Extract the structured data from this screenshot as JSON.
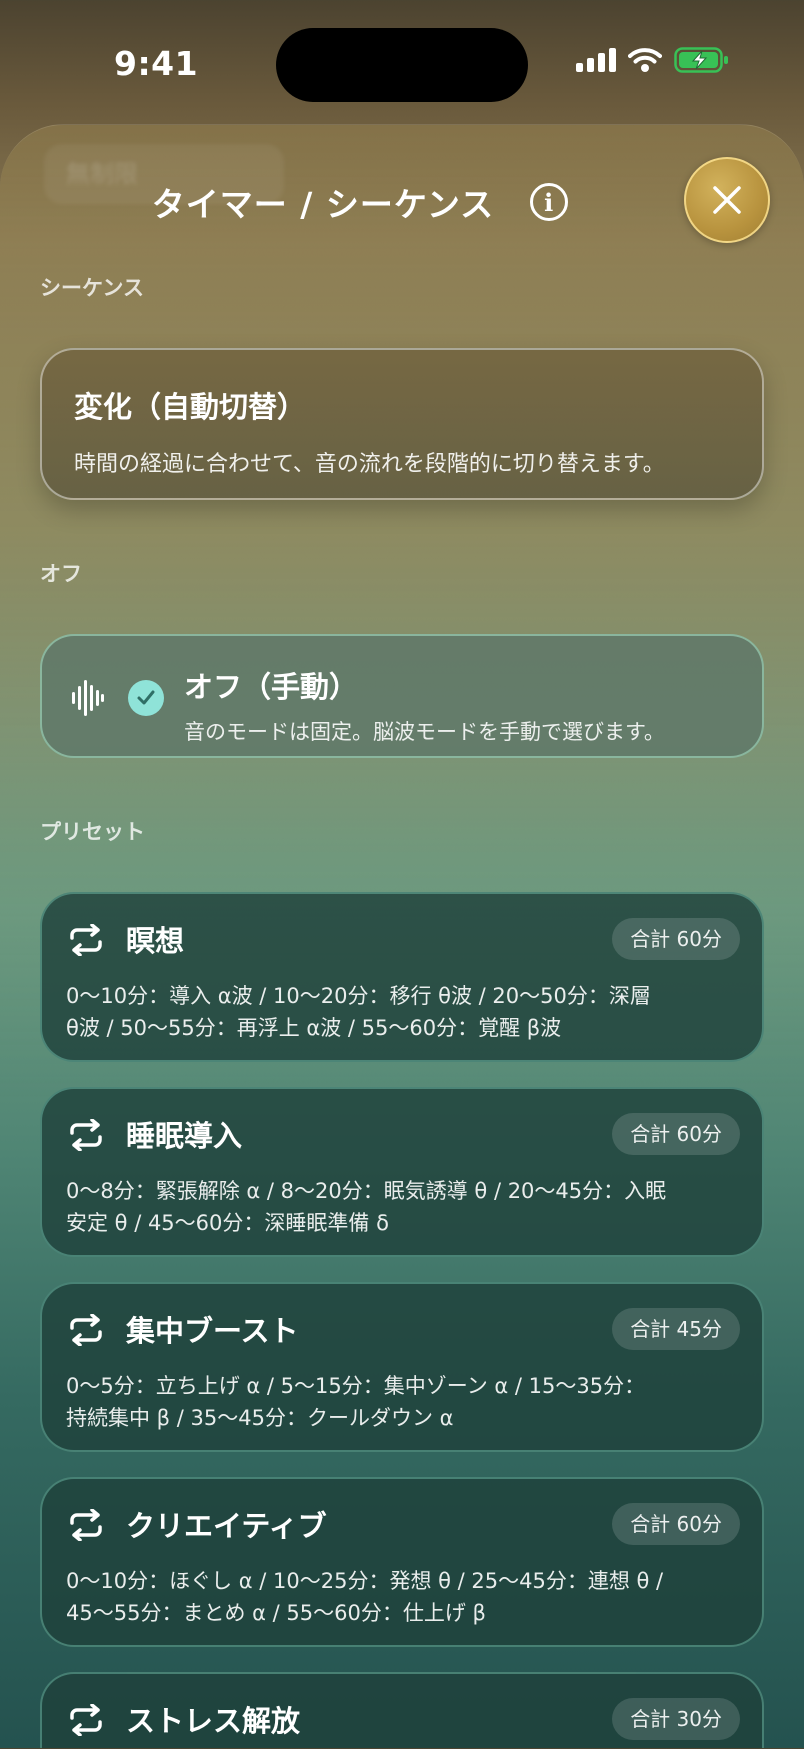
{
  "status_bar": {
    "time": "9:41"
  },
  "header": {
    "ghost_title": "無制限",
    "title": "タイマー / シーケンス",
    "info_icon": "info-icon",
    "close_icon": "close-icon"
  },
  "sections": {
    "sequence_label": "シーケンス",
    "off_label": "オフ",
    "preset_label": "プリセット"
  },
  "auto_card": {
    "title": "変化（自動切替）",
    "description": "時間の経過に合わせて、音の流れを段階的に切り替えます。"
  },
  "off_card": {
    "title": "オフ（手動）",
    "description": "音のモードは固定。脳波モードを手動で選びます。",
    "selected": true
  },
  "presets": [
    {
      "name": "瞑想",
      "badge": "合計 60分",
      "line1": "0〜10分：導入 α波 / 10〜20分：移行 θ波 / 20〜50分：深層",
      "line2": "θ波 / 50〜55分：再浮上 α波 / 55〜60分：覚醒 β波"
    },
    {
      "name": "睡眠導入",
      "badge": "合計 60分",
      "line1": "0〜8分：緊張解除 α / 8〜20分：眠気誘導 θ / 20〜45分：入眠",
      "line2": "安定 θ / 45〜60分：深睡眠準備 δ"
    },
    {
      "name": "集中ブースト",
      "badge": "合計 45分",
      "line1": "0〜5分：立ち上げ α / 5〜15分：集中ゾーン α / 15〜35分：",
      "line2": "持続集中 β / 35〜45分：クールダウン α"
    },
    {
      "name": "クリエイティブ",
      "badge": "合計 60分",
      "line1": "0〜10分：ほぐし α / 10〜25分：発想 θ / 25〜45分：連想 θ /",
      "line2": "45〜55分：まとめ α / 55〜60分：仕上げ β"
    },
    {
      "name": "ストレス解放",
      "badge": "合計 30分"
    }
  ]
}
